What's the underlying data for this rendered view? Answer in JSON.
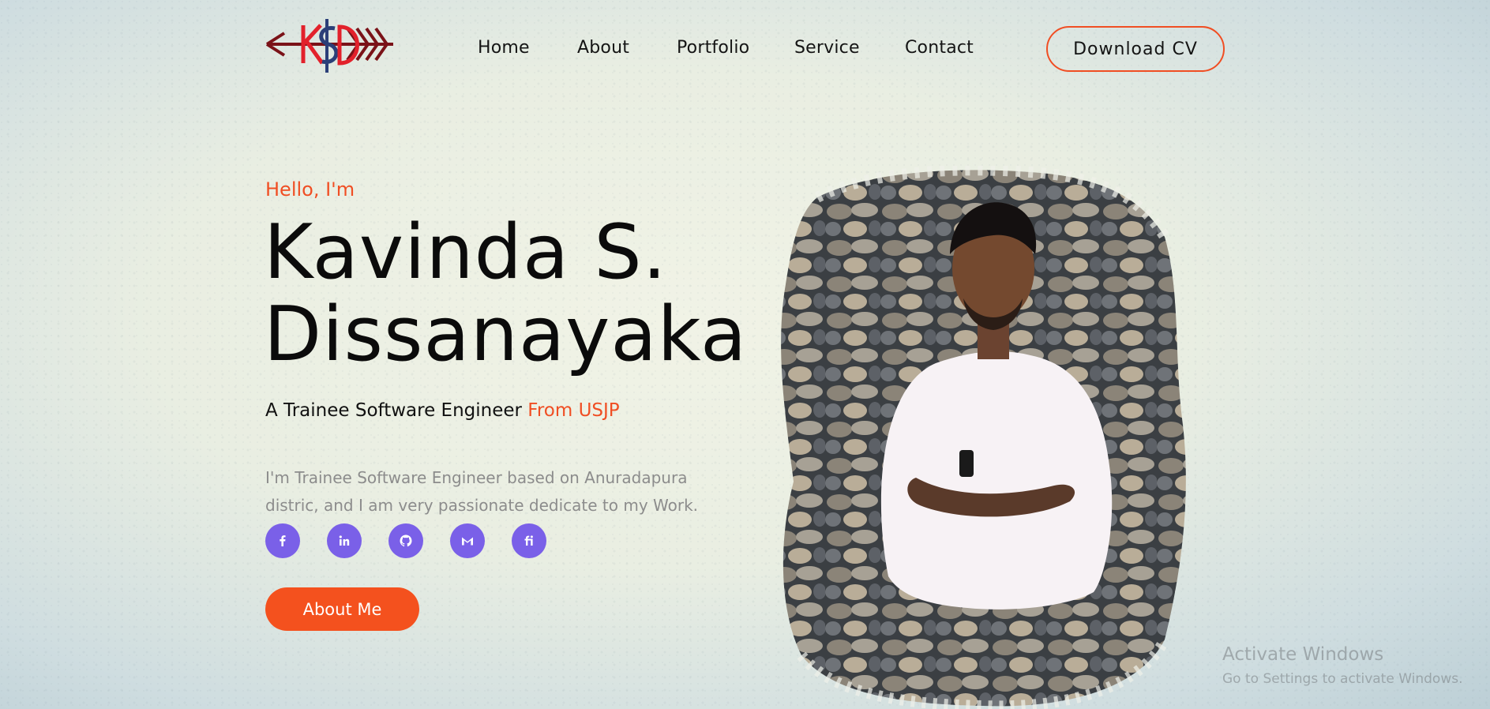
{
  "brand": {
    "logo_text": "KSD",
    "colors": {
      "accent": "#f04e23",
      "social": "#7a60e8",
      "dark": "#7a1218",
      "navy": "#2b3f78"
    }
  },
  "nav": {
    "items": [
      {
        "label": "Home"
      },
      {
        "label": "About"
      },
      {
        "label": "Portfolio"
      },
      {
        "label": "Service"
      },
      {
        "label": "Contact"
      }
    ],
    "cta_label": "Download CV"
  },
  "hero": {
    "greeting": "Hello, I'm",
    "name_line1": "Kavinda S.",
    "name_line2": "Dissanayaka",
    "role_main": "A Trainee Software Engineer",
    "role_highlight": "From USJP",
    "description": "I'm Trainee Software Engineer based on Anuradapura distric, and I am very passionate dedicate to my Work.",
    "socials": [
      {
        "icon": "facebook-icon"
      },
      {
        "icon": "linkedin-icon"
      },
      {
        "icon": "github-icon"
      },
      {
        "icon": "gmail-icon"
      },
      {
        "icon": "fiverr-icon"
      }
    ],
    "about_button_label": "About Me",
    "portrait_alt": "portrait-photo"
  },
  "watermark": {
    "title": "Activate Windows",
    "subtitle": "Go to Settings to activate Windows."
  }
}
